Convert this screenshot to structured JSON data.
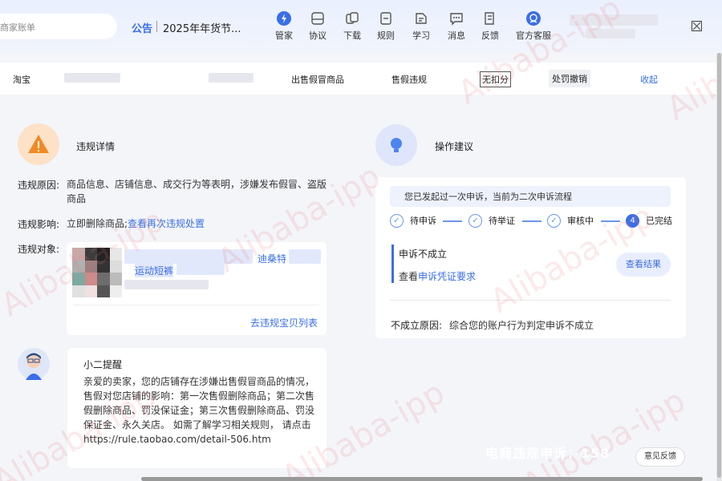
{
  "header": {
    "search_placeholder": "商家账单",
    "notice_label": "公告",
    "notice_text": "2025年年货节...",
    "nav": [
      {
        "label": "管家",
        "icon": "lightning-icon"
      },
      {
        "label": "协议",
        "icon": "agreement-icon"
      },
      {
        "label": "下载",
        "icon": "download-icon"
      },
      {
        "label": "规则",
        "icon": "rules-icon"
      },
      {
        "label": "学习",
        "icon": "learn-icon"
      },
      {
        "label": "消息",
        "icon": "message-icon"
      },
      {
        "label": "反馈",
        "icon": "feedback-icon"
      },
      {
        "label": "官方客服",
        "icon": "customer-service-icon"
      }
    ]
  },
  "record_row": {
    "platform": "淘宝",
    "violation_type": "出售假冒商品",
    "violation_category": "售假违规",
    "score": "无扣分",
    "status": "处罚撤销",
    "collapse": "收起"
  },
  "detail": {
    "title": "违规详情",
    "reason_label": "违规原因:",
    "reason_value": "商品信息、店铺信息、成交行为等表明，涉嫌发布假冒、盗版商品",
    "impact_label": "违规影响:",
    "impact_value": "立即删除商品;",
    "impact_link": "查看再次违规处置",
    "target_label": "违规对象:",
    "product_brand": "迪桑特",
    "product_name": "运动短裤",
    "go_list": "去违规宝贝列表"
  },
  "reminder": {
    "title": "小二提醒",
    "body": "亲爱的卖家，您的店铺存在涉嫌出售假冒商品的情况，售假对您店铺的影响：第一次售假删除商品；第二次售假删除商品、罚没保证金；第三次售假删除商品、罚没保证金、永久关店。 如需了解学习相关规则， 请点击https://rule.taobao.com/detail-506.htm"
  },
  "advice": {
    "title": "操作建议",
    "notice": "您已发起过一次申诉，当前为二次申诉流程",
    "steps": [
      "待申诉",
      "待举证",
      "审核中",
      "已完结"
    ],
    "final_step_number": "4",
    "result_title": "申诉不成立",
    "result_prefix": "查看",
    "result_link": "申诉凭证要求",
    "view_result": "查看结果",
    "reason_label": "不成立原因:",
    "reason_value": "综合您的账户行为判定申诉不成立"
  },
  "overlay": {
    "watermark": "Alibaba-ipp",
    "phone_text": "电商违规申诉：158",
    "feedback": "意见反馈"
  }
}
